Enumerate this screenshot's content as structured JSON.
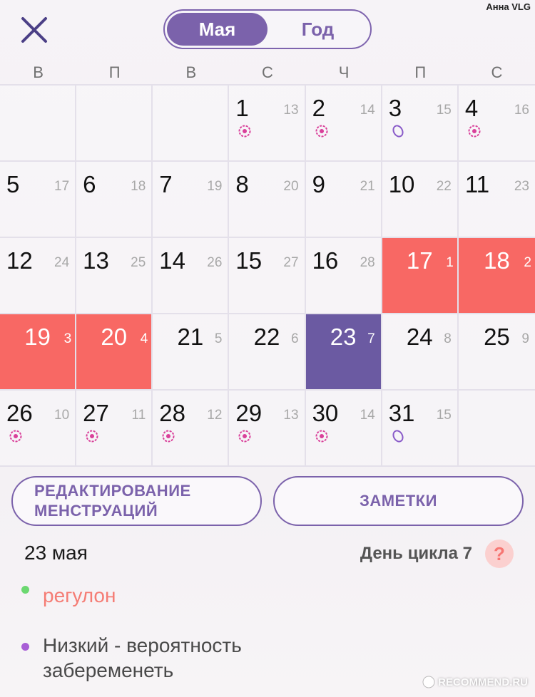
{
  "header": {
    "user_watermark": "Анна VLG",
    "toggle": {
      "month_label": "Мая",
      "year_label": "Год",
      "active": "month"
    }
  },
  "weekdays": [
    "В",
    "П",
    "В",
    "С",
    "Ч",
    "П",
    "С"
  ],
  "calendar": {
    "days": [
      {
        "day": "",
        "cycle": "",
        "mark": "",
        "state": "empty"
      },
      {
        "day": "",
        "cycle": "",
        "mark": "",
        "state": "empty"
      },
      {
        "day": "",
        "cycle": "",
        "mark": "",
        "state": "empty"
      },
      {
        "day": "1",
        "cycle": "13",
        "mark": "flower",
        "state": "normal"
      },
      {
        "day": "2",
        "cycle": "14",
        "mark": "flower",
        "state": "normal"
      },
      {
        "day": "3",
        "cycle": "15",
        "mark": "ovum",
        "state": "normal"
      },
      {
        "day": "4",
        "cycle": "16",
        "mark": "flower",
        "state": "normal"
      },
      {
        "day": "5",
        "cycle": "17",
        "mark": "",
        "state": "normal"
      },
      {
        "day": "6",
        "cycle": "18",
        "mark": "",
        "state": "normal"
      },
      {
        "day": "7",
        "cycle": "19",
        "mark": "",
        "state": "normal"
      },
      {
        "day": "8",
        "cycle": "20",
        "mark": "",
        "state": "normal"
      },
      {
        "day": "9",
        "cycle": "21",
        "mark": "",
        "state": "normal"
      },
      {
        "day": "10",
        "cycle": "22",
        "mark": "",
        "state": "normal"
      },
      {
        "day": "11",
        "cycle": "23",
        "mark": "",
        "state": "normal"
      },
      {
        "day": "12",
        "cycle": "24",
        "mark": "",
        "state": "normal"
      },
      {
        "day": "13",
        "cycle": "25",
        "mark": "",
        "state": "normal"
      },
      {
        "day": "14",
        "cycle": "26",
        "mark": "",
        "state": "normal"
      },
      {
        "day": "15",
        "cycle": "27",
        "mark": "",
        "state": "normal"
      },
      {
        "day": "16",
        "cycle": "28",
        "mark": "",
        "state": "normal"
      },
      {
        "day": "17",
        "cycle": "1",
        "mark": "",
        "state": "period"
      },
      {
        "day": "18",
        "cycle": "2",
        "mark": "",
        "state": "period"
      },
      {
        "day": "19",
        "cycle": "3",
        "mark": "",
        "state": "period"
      },
      {
        "day": "20",
        "cycle": "4",
        "mark": "",
        "state": "period"
      },
      {
        "day": "21",
        "cycle": "5",
        "mark": "",
        "state": "centered"
      },
      {
        "day": "22",
        "cycle": "6",
        "mark": "",
        "state": "centered"
      },
      {
        "day": "23",
        "cycle": "7",
        "mark": "",
        "state": "today"
      },
      {
        "day": "24",
        "cycle": "8",
        "mark": "",
        "state": "centered"
      },
      {
        "day": "25",
        "cycle": "9",
        "mark": "",
        "state": "centered"
      },
      {
        "day": "26",
        "cycle": "10",
        "mark": "flower",
        "state": "normal"
      },
      {
        "day": "27",
        "cycle": "11",
        "mark": "flower",
        "state": "normal"
      },
      {
        "day": "28",
        "cycle": "12",
        "mark": "flower",
        "state": "normal"
      },
      {
        "day": "29",
        "cycle": "13",
        "mark": "flower",
        "state": "normal"
      },
      {
        "day": "30",
        "cycle": "14",
        "mark": "flower",
        "state": "normal"
      },
      {
        "day": "31",
        "cycle": "15",
        "mark": "ovum",
        "state": "normal"
      },
      {
        "day": "",
        "cycle": "",
        "mark": "",
        "state": "empty"
      }
    ]
  },
  "actions": {
    "edit_label": "РЕДАКТИРОВАНИЕ\nМЕНСТРУАЦИЙ",
    "notes_label": "ЗАМЕТКИ"
  },
  "details": {
    "date": "23 мая",
    "cycle_day": "День цикла 7",
    "help_symbol": "?",
    "medication": "регулон",
    "probability": "Низкий - вероятность забеременеть"
  },
  "watermark": "RECOMMEND.RU",
  "colors": {
    "accent": "#7b62ab",
    "period": "#f86864",
    "today": "#6b5aa2",
    "flower_mark": "#d9409a",
    "ovum_mark": "#8a5cc9",
    "dot_green": "#6cd870",
    "dot_purple": "#a85ed6"
  }
}
